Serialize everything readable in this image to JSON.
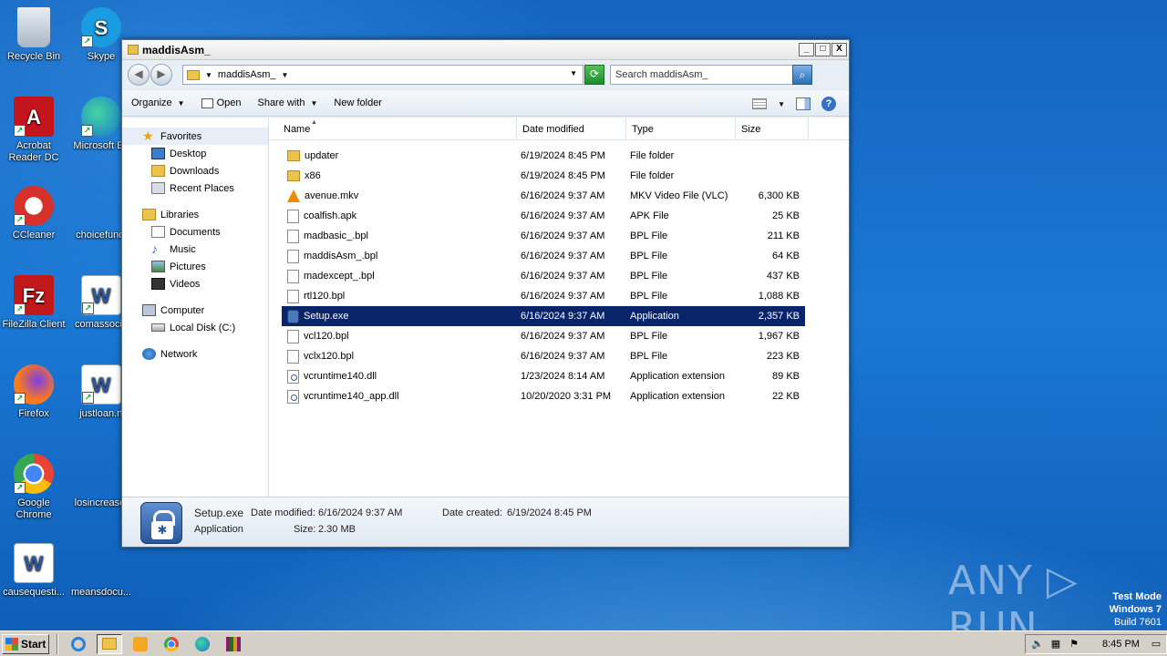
{
  "desktop": {
    "icons": [
      {
        "label": "Recycle Bin"
      },
      {
        "label": "Skype"
      },
      {
        "label": "Acrobat Reader DC"
      },
      {
        "label": "Microsoft Ed"
      },
      {
        "label": "CCleaner"
      },
      {
        "label": "choicefundi"
      },
      {
        "label": "FileZilla Client"
      },
      {
        "label": "comassocia"
      },
      {
        "label": "Firefox"
      },
      {
        "label": "justloan.rt"
      },
      {
        "label": "Google Chrome"
      },
      {
        "label": "losincrease."
      },
      {
        "label": "causequesti..."
      },
      {
        "label": "meansdocu..."
      }
    ],
    "watermark": "ANY ▷ RUN",
    "test_mode": {
      "line1": "Test Mode",
      "line2": "Windows 7",
      "line3": "Build 7601"
    }
  },
  "window": {
    "title": "maddisAsm_",
    "controls": {
      "minimize": "_",
      "maximize": "□",
      "close": "X"
    },
    "address": {
      "path": "maddisAsm_"
    },
    "search": {
      "placeholder": "Search maddisAsm_"
    },
    "toolbar": {
      "organize": "Organize",
      "open": "Open",
      "share_with": "Share with",
      "new_folder": "New folder"
    },
    "nav": {
      "favorites": "Favorites",
      "desktop": "Desktop",
      "downloads": "Downloads",
      "recent": "Recent Places",
      "libraries": "Libraries",
      "documents": "Documents",
      "music": "Music",
      "pictures": "Pictures",
      "videos": "Videos",
      "computer": "Computer",
      "local_disk": "Local Disk (C:)",
      "network": "Network"
    },
    "columns": {
      "name": "Name",
      "date": "Date modified",
      "type": "Type",
      "size": "Size"
    },
    "files": [
      {
        "name": "updater",
        "date": "6/19/2024 8:45 PM",
        "type": "File folder",
        "size": "",
        "icon": "folder-icon"
      },
      {
        "name": "x86",
        "date": "6/19/2024 8:45 PM",
        "type": "File folder",
        "size": "",
        "icon": "folder-icon"
      },
      {
        "name": "avenue.mkv",
        "date": "6/16/2024 9:37 AM",
        "type": "MKV Video File (VLC)",
        "size": "6,300 KB",
        "icon": "vlc-icon"
      },
      {
        "name": "coalfish.apk",
        "date": "6/16/2024 9:37 AM",
        "type": "APK File",
        "size": "25 KB",
        "icon": "file-icon"
      },
      {
        "name": "madbasic_.bpl",
        "date": "6/16/2024 9:37 AM",
        "type": "BPL File",
        "size": "211 KB",
        "icon": "file-icon"
      },
      {
        "name": "maddisAsm_.bpl",
        "date": "6/16/2024 9:37 AM",
        "type": "BPL File",
        "size": "64 KB",
        "icon": "file-icon"
      },
      {
        "name": "madexcept_.bpl",
        "date": "6/16/2024 9:37 AM",
        "type": "BPL File",
        "size": "437 KB",
        "icon": "file-icon"
      },
      {
        "name": "rtl120.bpl",
        "date": "6/16/2024 9:37 AM",
        "type": "BPL File",
        "size": "1,088 KB",
        "icon": "file-icon"
      },
      {
        "name": "Setup.exe",
        "date": "6/16/2024 9:37 AM",
        "type": "Application",
        "size": "2,357 KB",
        "icon": "app-icon"
      },
      {
        "name": "vcl120.bpl",
        "date": "6/16/2024 9:37 AM",
        "type": "BPL File",
        "size": "1,967 KB",
        "icon": "file-icon"
      },
      {
        "name": "vclx120.bpl",
        "date": "6/16/2024 9:37 AM",
        "type": "BPL File",
        "size": "223 KB",
        "icon": "file-icon"
      },
      {
        "name": "vcruntime140.dll",
        "date": "1/23/2024 8:14 AM",
        "type": "Application extension",
        "size": "89 KB",
        "icon": "dll-icon"
      },
      {
        "name": "vcruntime140_app.dll",
        "date": "10/20/2020 3:31 PM",
        "type": "Application extension",
        "size": "22 KB",
        "icon": "dll-icon"
      }
    ],
    "selected_index": 8,
    "details": {
      "name": "Setup.exe",
      "modified_label": "Date modified:",
      "modified": "6/16/2024 9:37 AM",
      "created_label": "Date created:",
      "created": "6/19/2024 8:45 PM",
      "type": "Application",
      "size_label": "Size:",
      "size": "2.30 MB"
    }
  },
  "taskbar": {
    "start": "Start",
    "clock": "8:45 PM"
  }
}
